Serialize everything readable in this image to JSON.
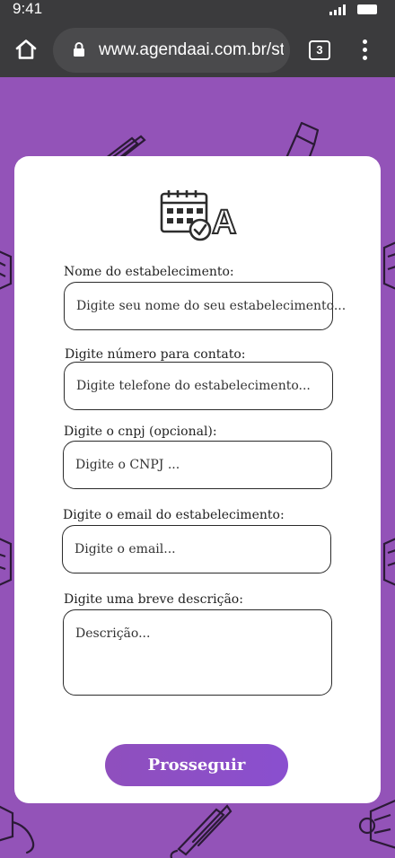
{
  "status_bar": {
    "time": "9:41"
  },
  "browser": {
    "url": "www.agendaai.com.br/st",
    "tab_count": "3"
  },
  "form": {
    "fields": [
      {
        "label": "Nome do estabelecimento:",
        "placeholder": "Digite seu nome do seu estabelecimento..."
      },
      {
        "label": "Digite número para contato:",
        "placeholder": "Digite  telefone do estabelecimento..."
      },
      {
        "label": "Digite o cnpj  (opcional):",
        "placeholder": "Digite o CNPJ ..."
      },
      {
        "label": "Digite o email do estabelecimento:",
        "placeholder": "Digite o email..."
      },
      {
        "label": "Digite uma breve descrição:",
        "placeholder": "Descrição..."
      }
    ],
    "submit_label": "Prosseguir"
  },
  "logo": {
    "text": "AI"
  },
  "colors": {
    "background": "#9353b8",
    "card": "#ffffff",
    "button": "#8a4fc6",
    "browser_bar": "#3b3b3d"
  }
}
